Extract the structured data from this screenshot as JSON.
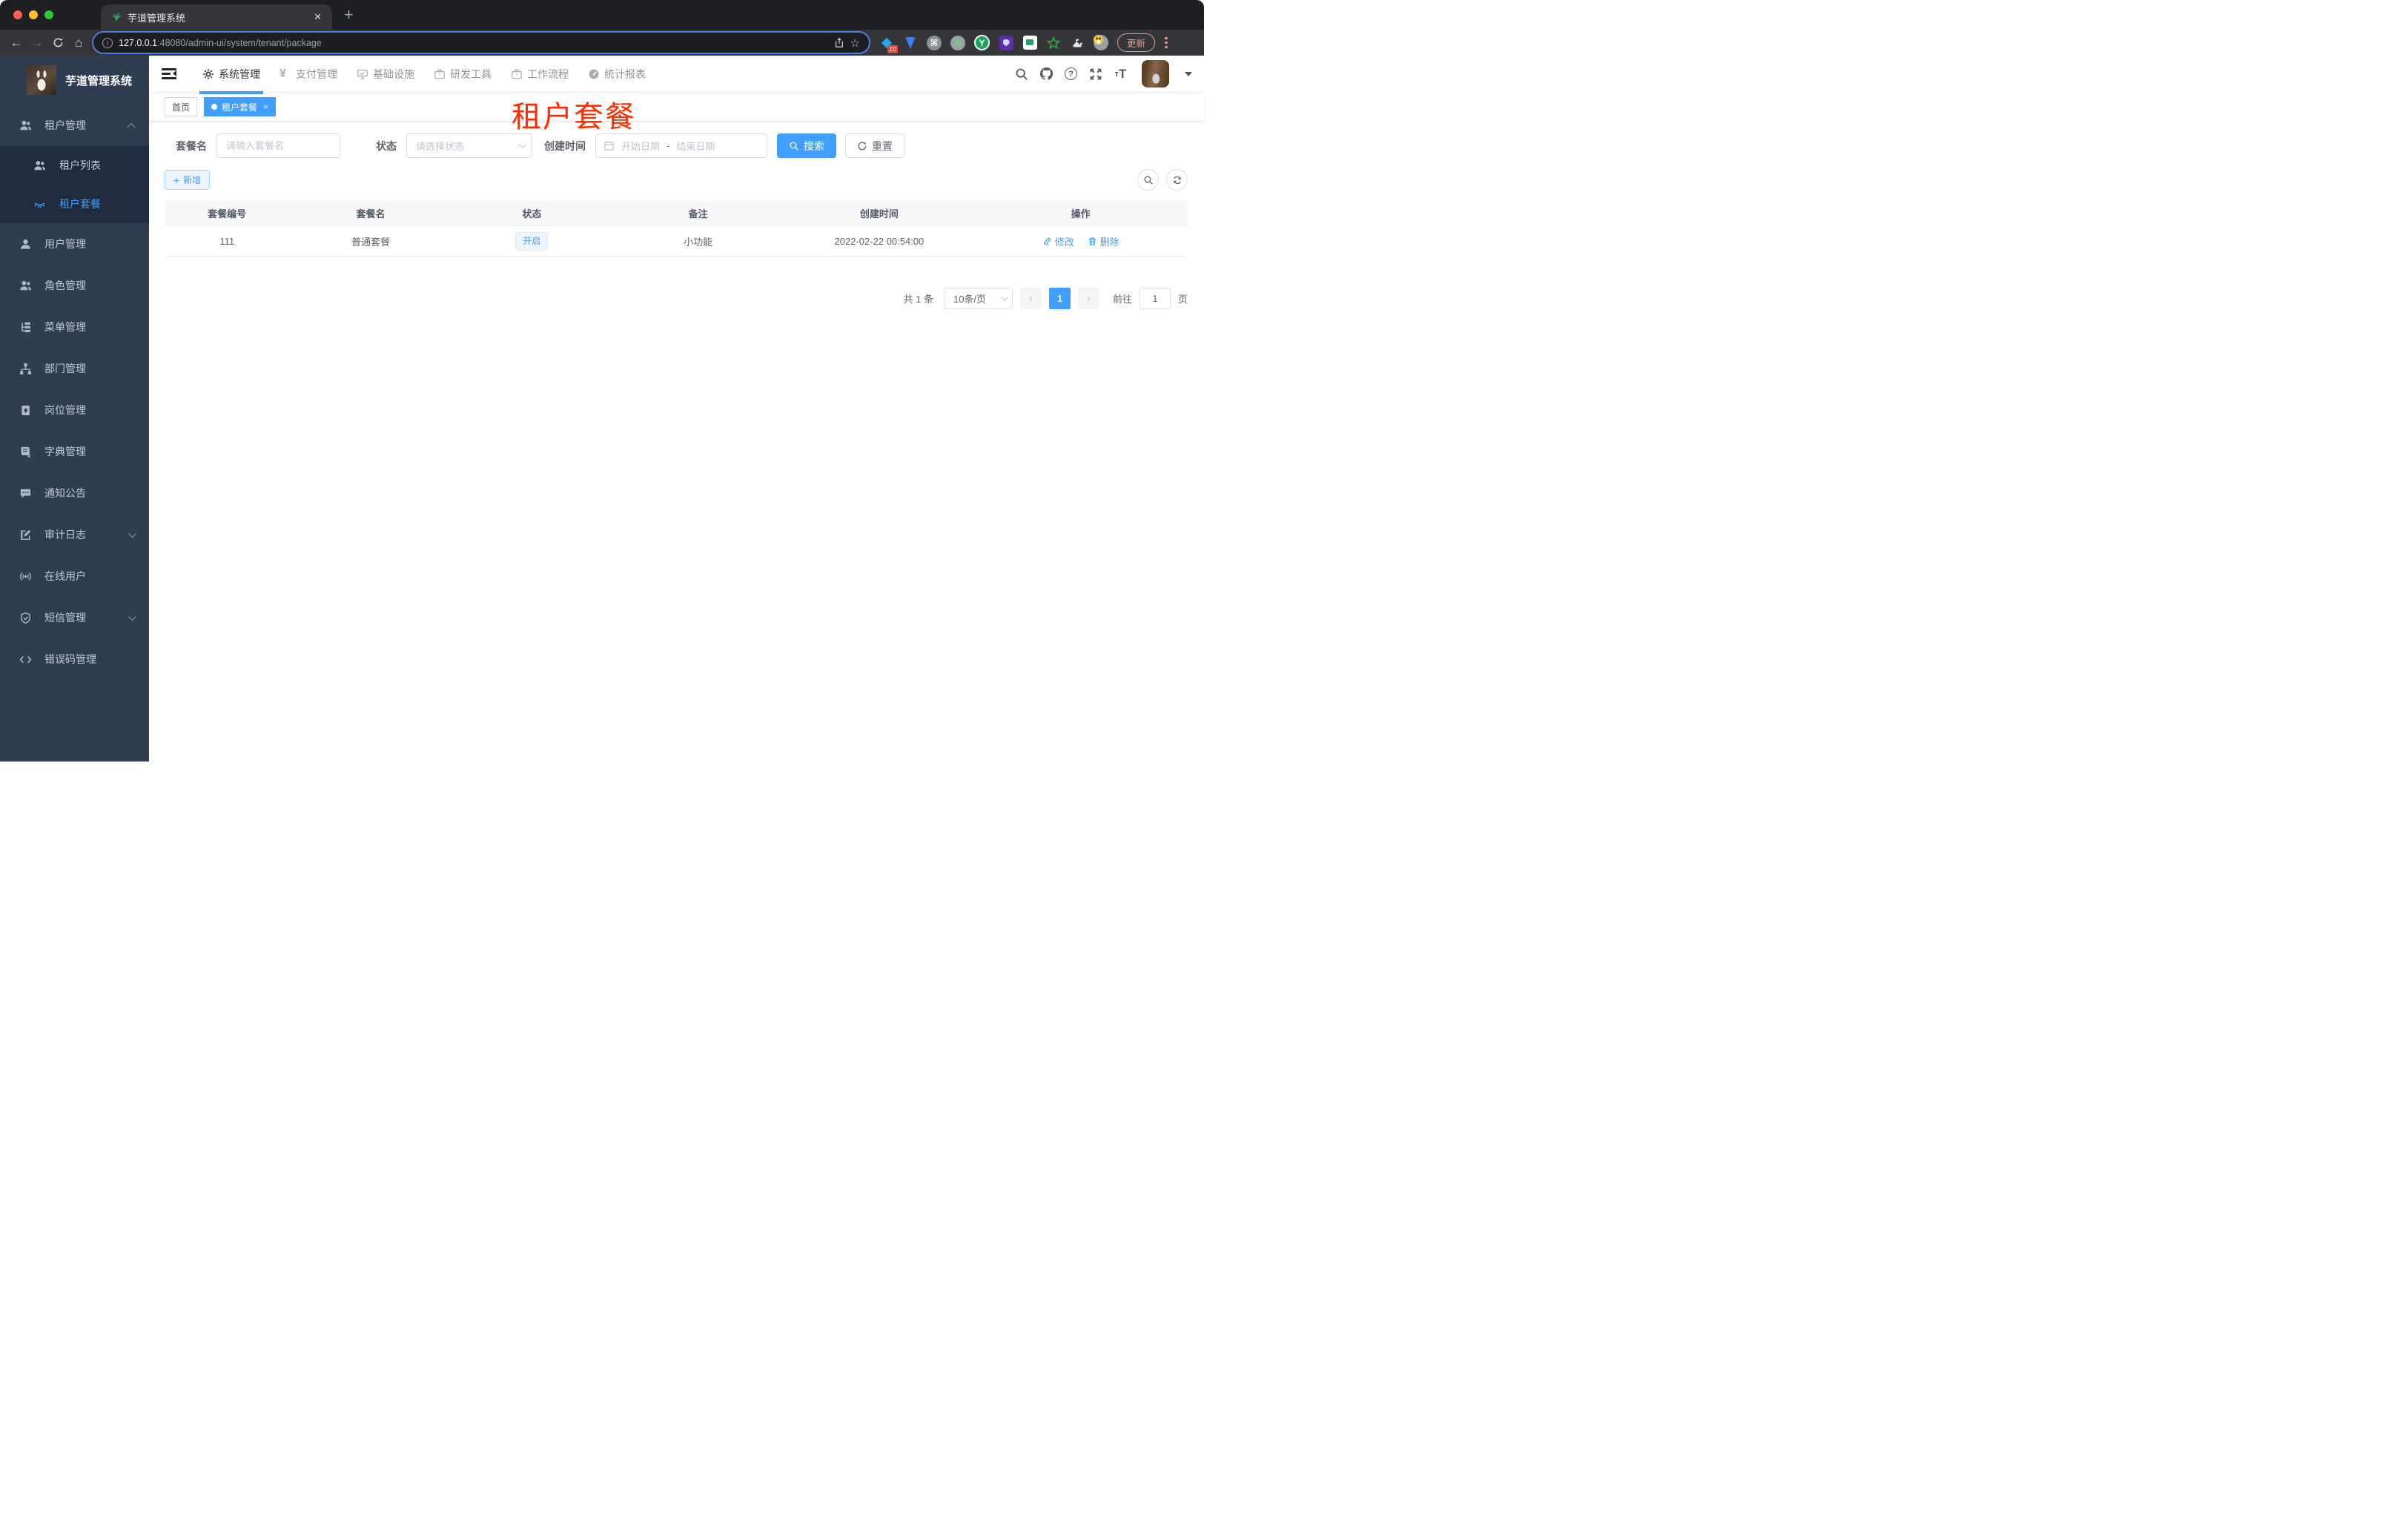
{
  "colors": {
    "accent": "#409eff",
    "annotation_red": "#ff2c00",
    "sidebar_bg": "#2f3d52",
    "sidebar_submenu_bg": "#1f2c3d",
    "status_tag_bg": "#ecf5ff",
    "status_tag_border": "#d9ecff"
  },
  "browser": {
    "tab_title": "芋道管理系统",
    "tab_close": "✕",
    "new_tab": "+",
    "url_host": "127.0.0.1",
    "url_rest": ":48080/admin-ui/system/tenant/package",
    "ext_badge": "10",
    "ext_y_letter": "Y",
    "cmd_glyph": "⌘",
    "puzzle_glyph": "▟",
    "update_label": "更新",
    "back_glyph": "←",
    "forward_glyph": "→",
    "home_glyph": "⌂",
    "share_star_glyph": "☆",
    "info_glyph": "i",
    "help_glyph": "?"
  },
  "sidebar": {
    "title": "芋道管理系统",
    "menu": [
      {
        "icon": "users-icon",
        "label": "租户管理"
      },
      {
        "icon": "users-icon",
        "label": "租户列表"
      },
      {
        "icon": "lashes-icon",
        "label": "租户套餐"
      },
      {
        "icon": "user-icon",
        "label": "用户管理"
      },
      {
        "icon": "users-icon",
        "label": "角色管理"
      },
      {
        "icon": "tree-icon",
        "label": "菜单管理"
      },
      {
        "icon": "org-icon",
        "label": "部门管理"
      },
      {
        "icon": "badge-icon",
        "label": "岗位管理"
      },
      {
        "icon": "dict-icon",
        "label": "字典管理"
      },
      {
        "icon": "message-icon",
        "label": "通知公告"
      },
      {
        "icon": "log-icon",
        "label": "审计日志"
      },
      {
        "icon": "online-icon",
        "label": "在线用户"
      },
      {
        "icon": "shield-icon",
        "label": "短信管理"
      },
      {
        "icon": "code-icon",
        "label": "错误码管理"
      }
    ]
  },
  "topnav": {
    "items": [
      {
        "icon": "gear-icon",
        "label": "系统管理",
        "active": true
      },
      {
        "icon": "yen-icon",
        "label": "支付管理",
        "yen": "¥"
      },
      {
        "icon": "monitor-icon",
        "label": "基础设施"
      },
      {
        "icon": "briefcase-icon",
        "label": "研发工具"
      },
      {
        "icon": "briefcase-icon",
        "label": "工作流程"
      },
      {
        "icon": "gauge-icon",
        "label": "统计报表"
      }
    ],
    "fontsize_small": "т",
    "fontsize_big": "T"
  },
  "tags": {
    "home": "首页",
    "active": "租户套餐",
    "close": "×"
  },
  "annotation": {
    "text": "租户套餐"
  },
  "filters": {
    "name_label": "套餐名",
    "name_placeholder": "请输入套餐名",
    "status_label": "状态",
    "status_placeholder": "请选择状态",
    "date_label": "创建时间",
    "date_start": "开始日期",
    "date_sep": "-",
    "date_end": "结束日期",
    "search_label": "搜索",
    "reset_label": "重置"
  },
  "toolbar": {
    "add_label": "新增",
    "plus": "+"
  },
  "table": {
    "columns": [
      "套餐编号",
      "套餐名",
      "状态",
      "备注",
      "创建时间",
      "操作"
    ],
    "rows": [
      {
        "id": "111",
        "name": "普通套餐",
        "status": "开启",
        "remark": "小功能",
        "created_at": "2022-02-22 00:54:00",
        "edit_label": "修改",
        "delete_label": "删除"
      }
    ]
  },
  "pagination": {
    "total": "共 1 条",
    "page_size": "10条/页",
    "prev": "‹",
    "page": "1",
    "next": "›",
    "goto_label": "前往",
    "goto_value": "1",
    "unit": "页"
  }
}
